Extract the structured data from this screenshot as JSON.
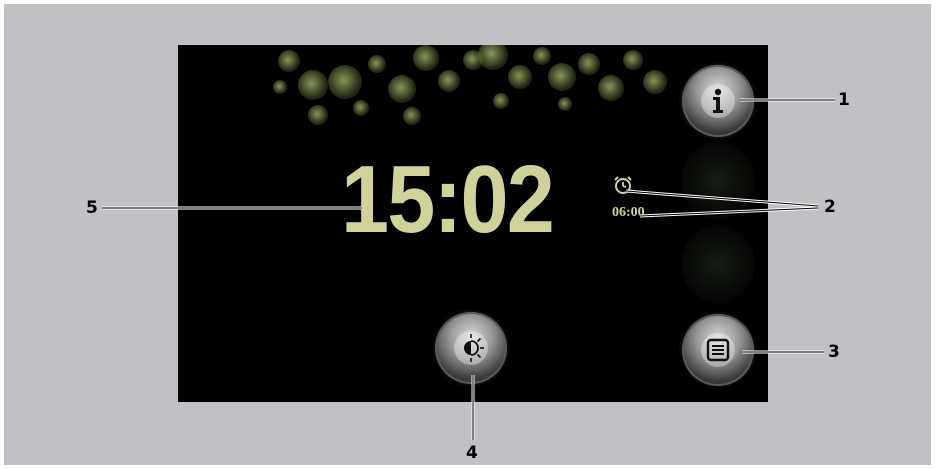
{
  "screen": {
    "clock_time": "15:02",
    "alarm_time": "06:00"
  },
  "icons": {
    "info": "info-icon",
    "alarm": "alarm-clock-icon",
    "menu": "list-menu-icon",
    "brightness": "brightness-icon"
  },
  "callouts": {
    "c1": "1",
    "c2": "2",
    "c3": "3",
    "c4": "4",
    "c5": "5"
  },
  "colors": {
    "background": "#c0c1c5",
    "screen": "#000000",
    "clock_text": "#d1d29a"
  }
}
